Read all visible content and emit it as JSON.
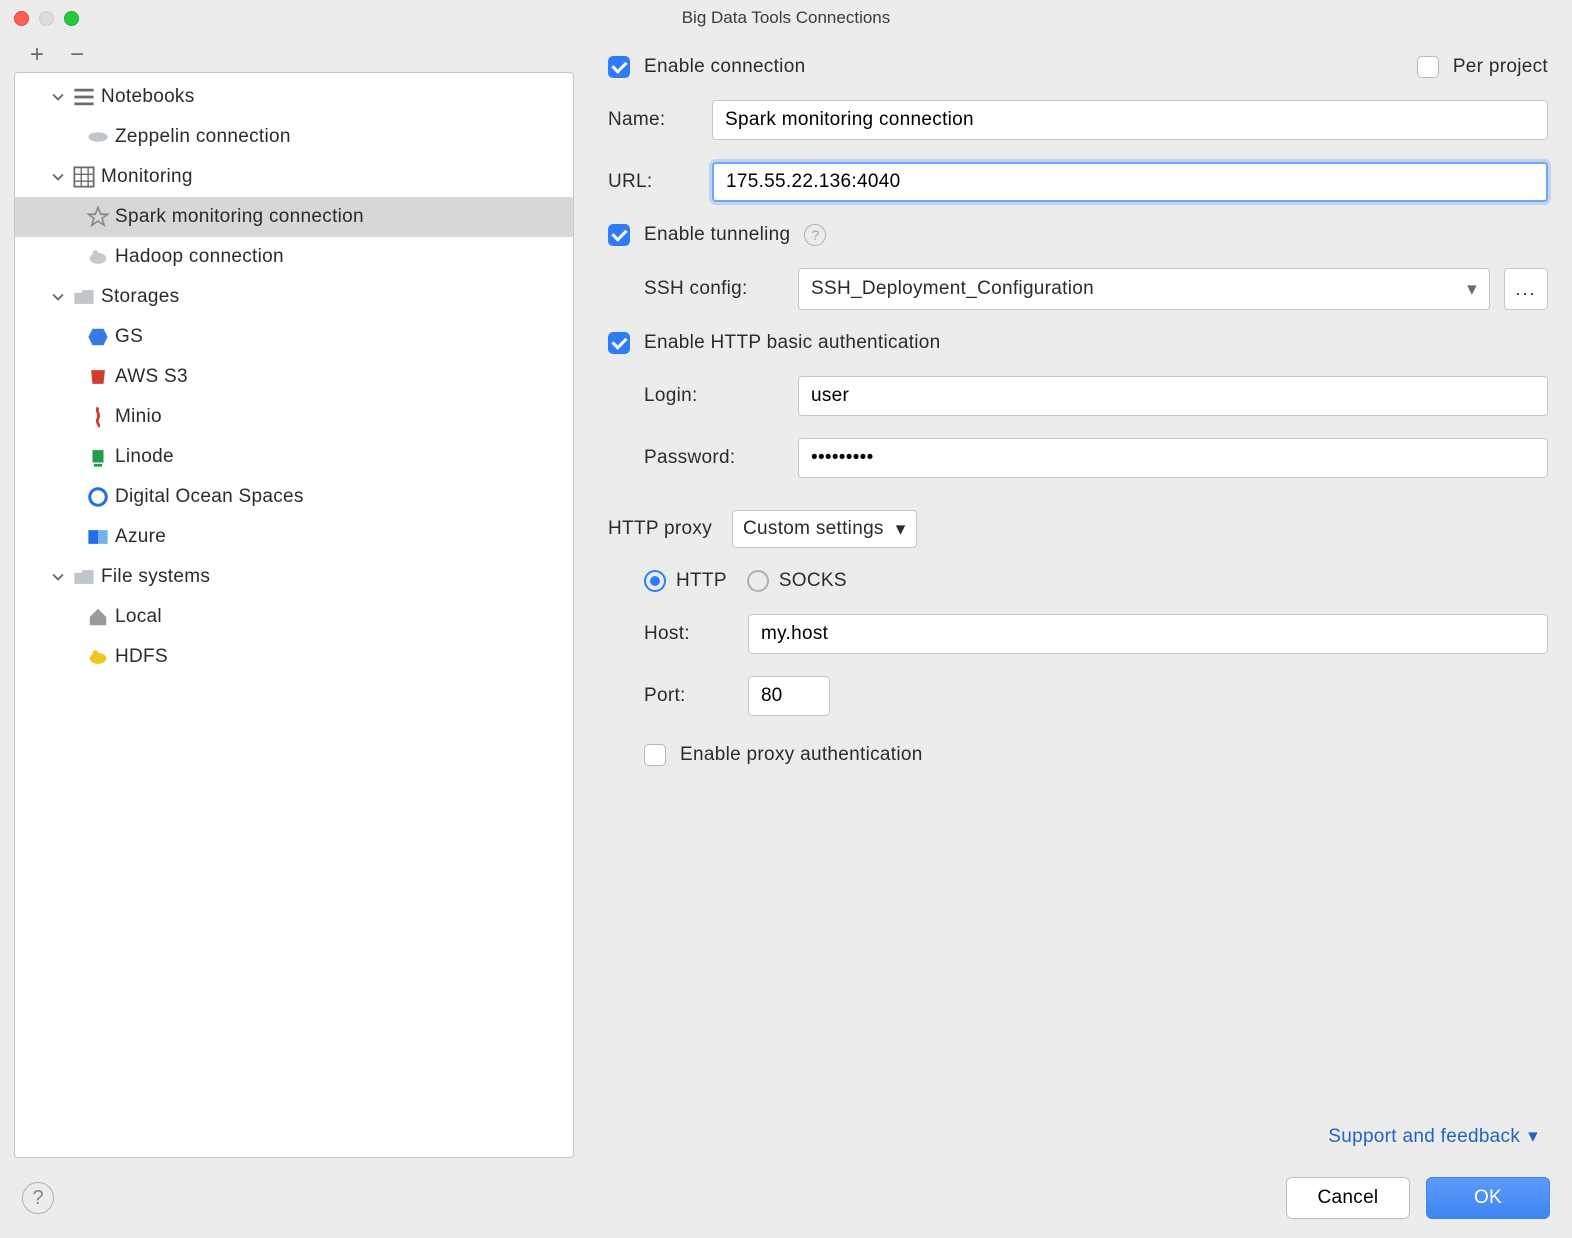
{
  "title": "Big Data Tools Connections",
  "sidebar": {
    "groups": [
      {
        "label": "Notebooks",
        "icon": "list",
        "items": [
          {
            "label": "Zeppelin connection",
            "icon": "zeppelin"
          }
        ]
      },
      {
        "label": "Monitoring",
        "icon": "grid",
        "items": [
          {
            "label": "Spark monitoring connection",
            "icon": "star",
            "selected": true
          },
          {
            "label": "Hadoop connection",
            "icon": "hadoop"
          }
        ]
      },
      {
        "label": "Storages",
        "icon": "folder-cloud",
        "items": [
          {
            "label": "GS",
            "icon": "gs"
          },
          {
            "label": "AWS S3",
            "icon": "aws"
          },
          {
            "label": "Minio",
            "icon": "minio"
          },
          {
            "label": "Linode",
            "icon": "linode"
          },
          {
            "label": "Digital Ocean Spaces",
            "icon": "do"
          },
          {
            "label": "Azure",
            "icon": "azure"
          }
        ]
      },
      {
        "label": "File systems",
        "icon": "folder",
        "items": [
          {
            "label": "Local",
            "icon": "home"
          },
          {
            "label": "HDFS",
            "icon": "hdfs"
          }
        ]
      }
    ]
  },
  "form": {
    "enable_connection": {
      "label": "Enable connection",
      "checked": true
    },
    "per_project": {
      "label": "Per project",
      "checked": false
    },
    "name": {
      "label": "Name:",
      "value": "Spark monitoring connection"
    },
    "url": {
      "label": "URL:",
      "value": "175.55.22.136:4040"
    },
    "enable_tunneling": {
      "label": "Enable tunneling",
      "checked": true
    },
    "ssh_config": {
      "label": "SSH config:",
      "value": "SSH_Deployment_Configuration"
    },
    "enable_http_auth": {
      "label": "Enable HTTP basic authentication",
      "checked": true
    },
    "login": {
      "label": "Login:",
      "value": "user"
    },
    "password": {
      "label": "Password:",
      "value": "•••••••••"
    },
    "http_proxy": {
      "label": "HTTP proxy",
      "value": "Custom settings"
    },
    "proxy_type": {
      "http": "HTTP",
      "socks": "SOCKS"
    },
    "host": {
      "label": "Host:",
      "value": "my.host"
    },
    "port": {
      "label": "Port:",
      "value": "80"
    },
    "enable_proxy_auth": {
      "label": "Enable proxy authentication",
      "checked": false
    }
  },
  "link": "Support and feedback",
  "footer": {
    "cancel": "Cancel",
    "ok": "OK"
  },
  "ellipsis": "..."
}
